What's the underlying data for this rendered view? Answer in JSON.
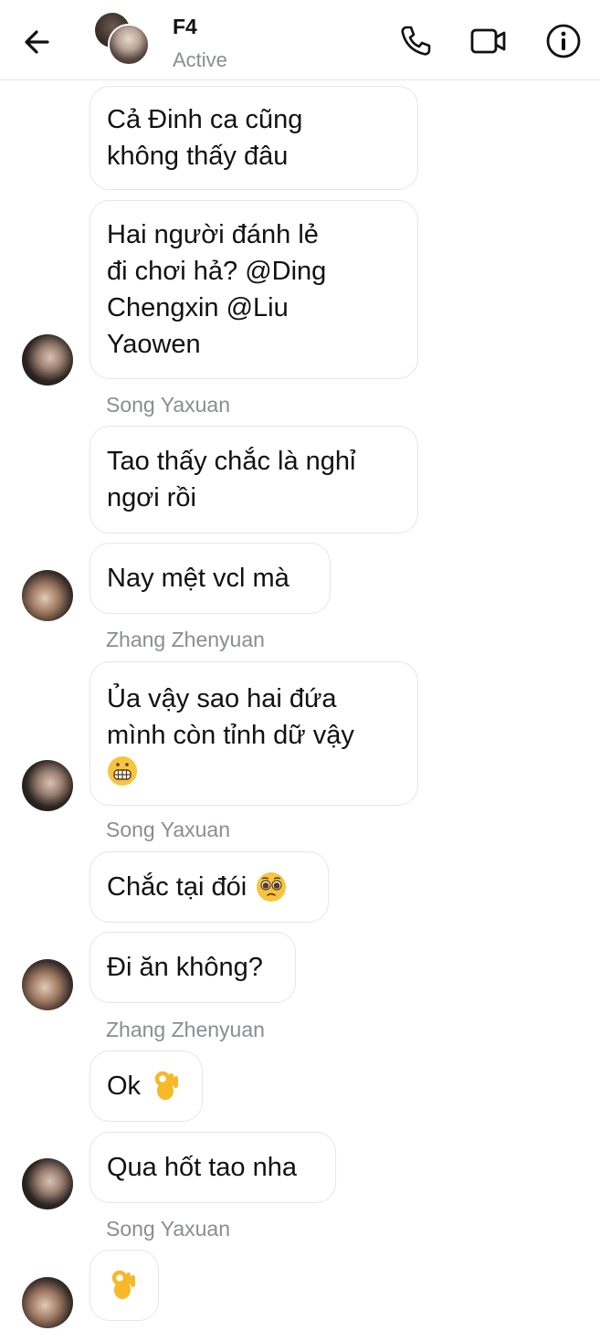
{
  "header": {
    "title": "F4",
    "status": "Active",
    "icons": {
      "back": "arrow-left-icon",
      "phone": "phone-icon",
      "video": "video-camera-icon",
      "info": "info-icon"
    }
  },
  "messages": [
    {
      "text": "Cả Đinh ca cũng\nkhông thấy đâu"
    },
    {
      "text": "Hai người đánh lẻ\nđi chơi hả? @Ding\nChengxin @Liu\nYaowen"
    },
    {
      "sender": "Song Yaxuan"
    },
    {
      "text": "Tao thấy chắc là nghỉ\nngơi rồi"
    },
    {
      "text": "Nay mệt vcl mà"
    },
    {
      "sender": "Zhang Zhenyuan"
    },
    {
      "text": "Ủa vậy sao hai đứa\nmình còn tỉnh dữ vậy",
      "emoji": "grimacing-face-emoji"
    },
    {
      "sender": "Song Yaxuan"
    },
    {
      "text": "Chắc tại đói",
      "emoji": "pleading-face-emoji"
    },
    {
      "text": "Đi ăn không?"
    },
    {
      "sender": "Zhang Zhenyuan"
    },
    {
      "text": "Ok",
      "emoji": "ok-hand-emoji"
    },
    {
      "text": "Qua hốt tao nha"
    },
    {
      "sender": "Song Yaxuan"
    },
    {
      "emoji": "ok-hand-emoji"
    }
  ],
  "colors": {
    "bubble_border": "#e4e6eb",
    "secondary_text": "#8a8d91",
    "emoji_yellow": "#f7b928"
  }
}
